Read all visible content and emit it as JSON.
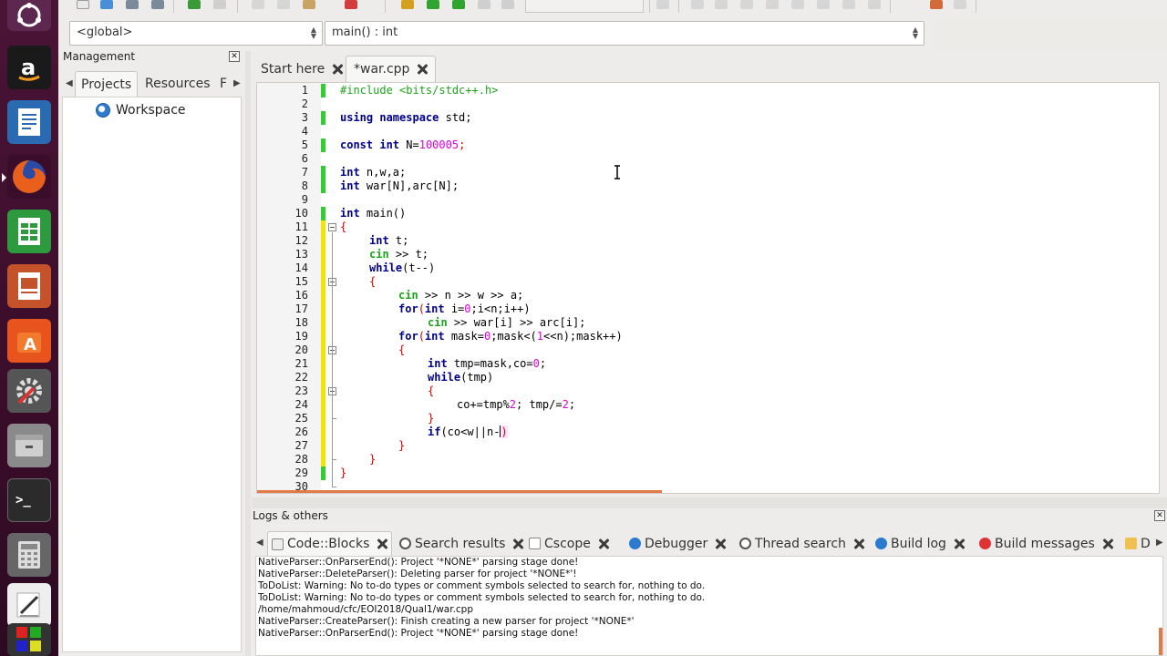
{
  "scope": {
    "global": "<global>",
    "function": "main() : int"
  },
  "management": {
    "title": "Management",
    "tabs": [
      "Projects",
      "Resources",
      "F"
    ],
    "workspace": "Workspace"
  },
  "editor": {
    "tabs": [
      {
        "label": "Start here"
      },
      {
        "label": "*war.cpp"
      }
    ],
    "line_numbers": [
      "1",
      "2",
      "3",
      "4",
      "5",
      "6",
      "7",
      "8",
      "9",
      "10",
      "11",
      "12",
      "13",
      "14",
      "15",
      "16",
      "17",
      "18",
      "19",
      "20",
      "21",
      "22",
      "23",
      "24",
      "25",
      "26",
      "27",
      "28",
      "29",
      "30"
    ],
    "code": {
      "l1": "#include <bits/stdc++.h>",
      "l3_kw": "using namespace",
      "l3_rest": " std;",
      "l5_kw": "const int",
      "l5_a": " N=",
      "l5_num": "100005",
      "l5_end": ";",
      "l7_kw": "int",
      "l7_rest": " n,w,a;",
      "l8_kw": "int",
      "l8_rest": " war[N],arc[N];",
      "l10_kw": "int",
      "l10_rest": " main()",
      "open": "{",
      "close": "}",
      "l12_kw": "int",
      "l12_rest": " t;",
      "cin": "cin",
      "l13_rest": " >> t;",
      "l14_kw": "while",
      "l14_rest": "(t--)",
      "l16_rest": " >> n >> w >> a;",
      "l17_kw": "for",
      "l17_p1": "(",
      "l17_kw2": "int",
      "l17_p2": " i=",
      "l17_num": "0",
      "l17_p3": ";i<n;i++)",
      "l18_rest": " >> war[i] >> arc[i];",
      "l19_p2": " mask=",
      "l19_num": "0",
      "l19_p3": ";mask<(",
      "l19_num2": "1",
      "l19_p4": "<<n);mask++)",
      "l21_kw": "int",
      "l21_a": " tmp=mask,co=",
      "l21_num": "0",
      "l21_end": ";",
      "l22_kw": "while",
      "l22_rest": "(tmp)",
      "l24_a": "co+=tmp%",
      "l24_num": "2",
      "l24_b": "; tmp/=",
      "l24_num2": "2",
      "l24_end": ";",
      "l26_kw": "if",
      "l26_a": "(co<w||n-",
      "l26_end": ")"
    }
  },
  "logs": {
    "title": "Logs & others",
    "tabs": [
      "Code::Blocks",
      "Search results",
      "Cscope",
      "Debugger",
      "Thread search",
      "Build log",
      "Build messages",
      "D"
    ],
    "lines": [
      "NativeParser::OnParserEnd(): Project '*NONE*' parsing stage done!",
      "NativeParser::DeleteParser(): Deleting parser for project '*NONE*'!",
      "ToDoList: Warning: No to-do types or comment symbols selected to search for, nothing to do.",
      "ToDoList: Warning: No to-do types or comment symbols selected to search for, nothing to do.",
      "/home/mahmoud/cfc/EOI2018/Qual1/war.cpp",
      "NativeParser::CreateParser(): Finish creating a new parser for project '*NONE*'",
      "NativeParser::OnParserEnd(): Project '*NONE*' parsing stage done!"
    ]
  },
  "colors": {
    "keyword": "#00008b",
    "preprocessor": "#1ca31c",
    "number": "#e000e0",
    "operator": "#d80000",
    "launcher": "#3a0d2a",
    "accent": "#e27a47"
  }
}
